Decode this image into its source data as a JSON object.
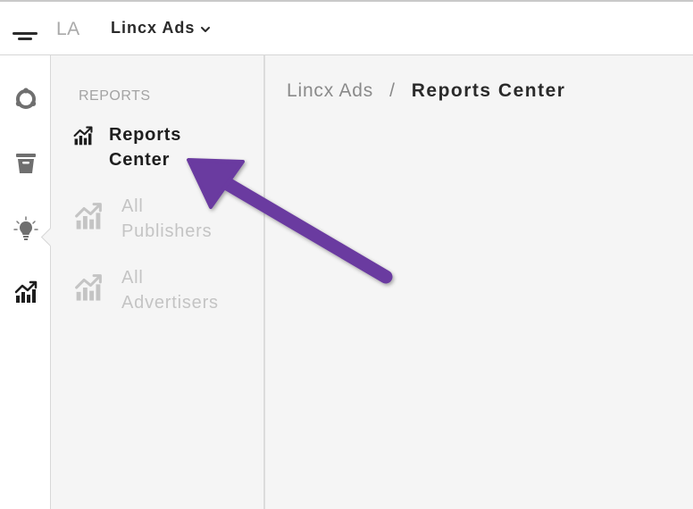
{
  "topbar": {
    "org_initials": "LA",
    "org_name": "Lincx Ads"
  },
  "rail": {
    "items": [
      {
        "icon": "ring-icon"
      },
      {
        "icon": "archive-box-icon"
      },
      {
        "icon": "lightbulb-icon"
      },
      {
        "icon": "chart-trend-icon",
        "active": true
      }
    ]
  },
  "subnav": {
    "heading": "REPORTS",
    "items": [
      {
        "label": "Reports Center",
        "state": "active",
        "icon": "chart-trend-icon"
      },
      {
        "label": "All Publishers",
        "state": "disabled",
        "icon": "chart-trend-icon"
      },
      {
        "label": "All Advertisers",
        "state": "disabled",
        "icon": "chart-trend-icon"
      }
    ]
  },
  "breadcrumb": {
    "root": "Lincx Ads",
    "separator": "/",
    "current": "Reports Center"
  },
  "colors": {
    "annotation_arrow": "#6b3aa0",
    "active_text": "#1e1e1e",
    "disabled_text": "#c4c4c4",
    "muted_text": "#a3a3a3"
  }
}
